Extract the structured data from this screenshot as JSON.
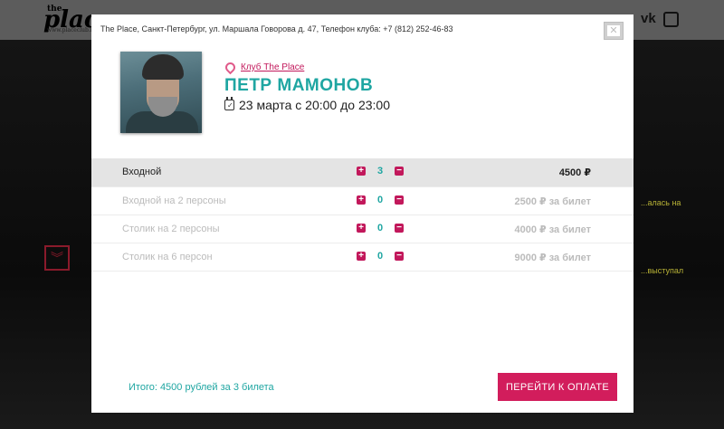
{
  "background": {
    "logo_small": "the",
    "logo": "place",
    "logo_url": "www.placeclub.ru",
    "social": {
      "vk": "vk",
      "instagram": "instagram-icon"
    },
    "side_texts": [
      "...алась на",
      "...выступал"
    ]
  },
  "modal": {
    "address": "The Place, Санкт-Петербург, ул. Маршала Говорова д. 47, Телефон клуба: +7 (812) 252-46-83",
    "close_label": "✕",
    "venue_link": "Клуб The Place",
    "artist": "ПЕТР МАМОНОВ",
    "date": "23 марта с 20:00 до 23:00",
    "tickets": [
      {
        "name": "Входной",
        "qty": "3",
        "price": "4500 ₽",
        "active": true
      },
      {
        "name": "Входной на 2 персоны",
        "qty": "0",
        "price": "2500 ₽ за билет",
        "active": false
      },
      {
        "name": "Столик на 2 персоны",
        "qty": "0",
        "price": "4000 ₽ за билет",
        "active": false
      },
      {
        "name": "Столик на 6 персон",
        "qty": "0",
        "price": "9000 ₽ за билет",
        "active": false
      }
    ],
    "plus": "+",
    "minus": "−",
    "total": "Итого: 4500 рублей за 3 билета",
    "pay_button": "ПЕРЕЙТИ К ОПЛАТЕ"
  },
  "colors": {
    "accent": "#c2185b",
    "teal": "#1fa6a2",
    "button": "#d21d5c"
  }
}
